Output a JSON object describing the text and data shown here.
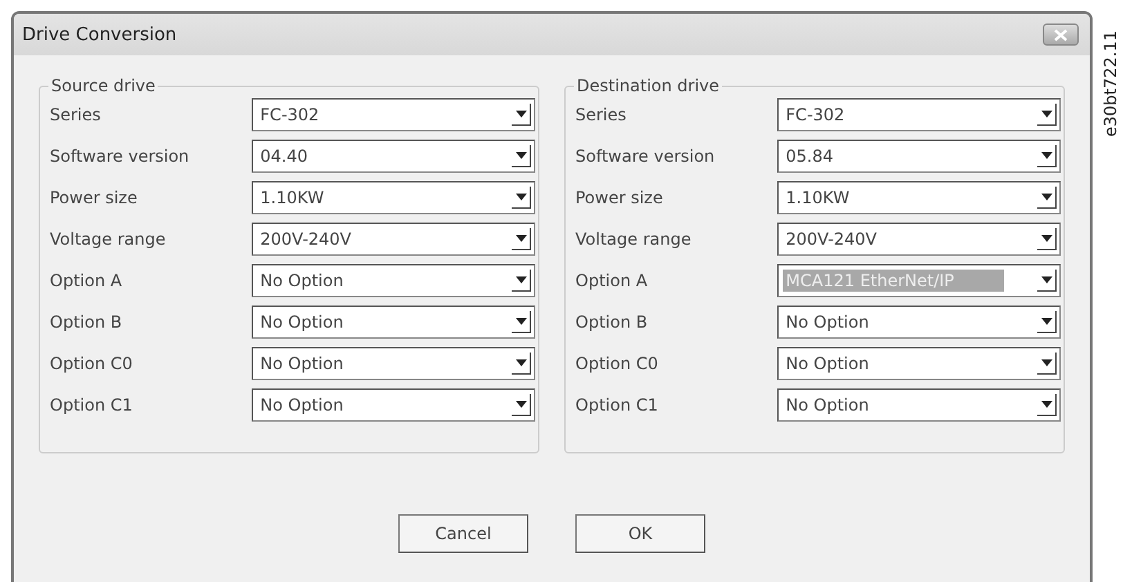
{
  "window": {
    "title": "Drive Conversion"
  },
  "groups": [
    {
      "title": "Source drive",
      "fields": [
        {
          "label": "Series",
          "value": "FC-302",
          "highlighted": false
        },
        {
          "label": "Software version",
          "value": "04.40",
          "highlighted": false
        },
        {
          "label": "Power size",
          "value": "1.10KW",
          "highlighted": false
        },
        {
          "label": "Voltage range",
          "value": "200V-240V",
          "highlighted": false
        },
        {
          "label": "Option A",
          "value": "No Option",
          "highlighted": false
        },
        {
          "label": "Option B",
          "value": "No Option",
          "highlighted": false
        },
        {
          "label": "Option C0",
          "value": "No Option",
          "highlighted": false
        },
        {
          "label": "Option C1",
          "value": "No Option",
          "highlighted": false
        }
      ]
    },
    {
      "title": "Destination drive",
      "fields": [
        {
          "label": "Series",
          "value": "FC-302",
          "highlighted": false
        },
        {
          "label": "Software version",
          "value": "05.84",
          "highlighted": false
        },
        {
          "label": "Power size",
          "value": "1.10KW",
          "highlighted": false
        },
        {
          "label": "Voltage range",
          "value": "200V-240V",
          "highlighted": false
        },
        {
          "label": "Option A",
          "value": "MCA121 EtherNet/IP",
          "highlighted": true
        },
        {
          "label": "Option B",
          "value": "No Option",
          "highlighted": false
        },
        {
          "label": "Option C0",
          "value": "No Option",
          "highlighted": false
        },
        {
          "label": "Option C1",
          "value": "No Option",
          "highlighted": false
        }
      ]
    }
  ],
  "buttons": [
    "Cancel",
    "OK"
  ],
  "figure_id": "e30bt722.11"
}
